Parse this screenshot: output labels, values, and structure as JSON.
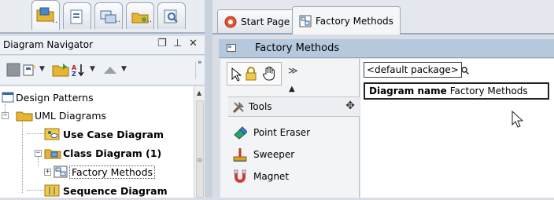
{
  "left_tabs": [
    {
      "icon": "diagram-folder-icon",
      "active": true
    },
    {
      "icon": "document-icon"
    },
    {
      "icon": "windows-icon"
    },
    {
      "icon": "model-icon"
    },
    {
      "icon": "search-icon"
    }
  ],
  "navigator": {
    "title": "Diagram Navigator",
    "controls": [
      "restore-icon",
      "pin-icon",
      "close-icon"
    ],
    "tree": [
      {
        "label": "Design Patterns",
        "bold": false
      },
      {
        "label": "UML Diagrams",
        "bold": false,
        "expander": "−"
      },
      {
        "label": "Use Case Diagram",
        "bold": true
      },
      {
        "label": "Class Diagram (1)",
        "bold": true,
        "expander": "−"
      },
      {
        "label": "Factory Methods",
        "bold": false,
        "expander": "+",
        "selected": true
      },
      {
        "label": "Sequence Diagram",
        "bold": true
      }
    ]
  },
  "editor": {
    "tabs": [
      {
        "label": "Start Page",
        "icon": "start-page-icon"
      },
      {
        "label": "Factory Methods",
        "icon": "class-diagram-icon",
        "active": true
      }
    ],
    "diagram_title": "Factory Methods"
  },
  "palette": {
    "section": "Tools",
    "items": [
      {
        "label": "Point Eraser",
        "icon": "eraser-icon"
      },
      {
        "label": "Sweeper",
        "icon": "sweeper-icon"
      },
      {
        "label": "Magnet",
        "icon": "magnet-icon"
      }
    ]
  },
  "canvas": {
    "package": "<default package>",
    "diagram_name_key": "Diagram name",
    "diagram_name_value": "Factory Methods"
  },
  "colors": {
    "diagram_header": "#b6c8dc",
    "folder": "#e8b530",
    "selected_tab": "#f5f6f8"
  }
}
